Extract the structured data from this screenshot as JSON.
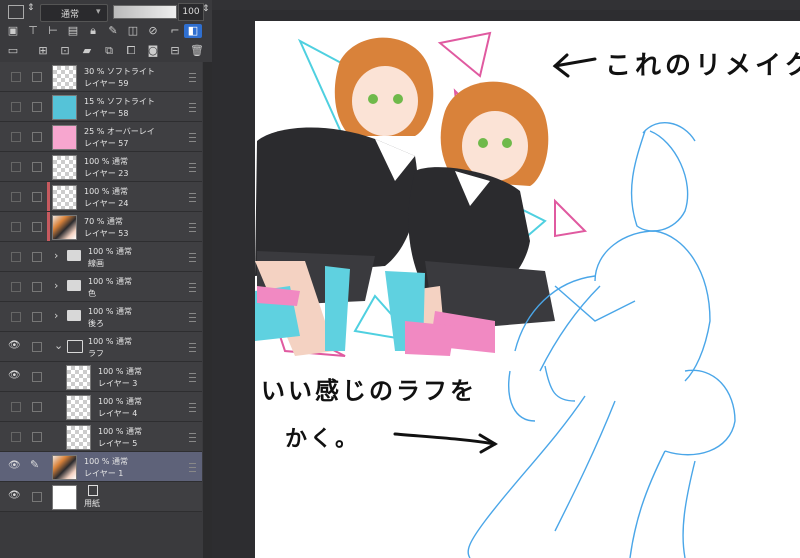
{
  "toolbar": {
    "blend_mode": "通常",
    "opacity": "100",
    "icons": [
      "layer-palette-icon",
      "new-raster-layer-icon",
      "new-vector-layer-icon",
      "lock-icon",
      "clip-icon",
      "reference-icon",
      "draft-icon",
      "mask-icon",
      "color-icon",
      "delete-icon"
    ]
  },
  "layers": [
    {
      "blend": "30 % ソフトライト",
      "name": "レイヤー 59",
      "thumb": "checker",
      "visible": false,
      "indent": 0
    },
    {
      "blend": "15 % ソフトライト",
      "name": "レイヤー 58",
      "thumb": "#55c3d8",
      "visible": false,
      "indent": 0
    },
    {
      "blend": "25 % オーバーレイ",
      "name": "レイヤー 57",
      "thumb": "#f7a6cf",
      "visible": false,
      "indent": 0
    },
    {
      "blend": "100 % 通常",
      "name": "レイヤー 23",
      "thumb": "checker",
      "visible": false,
      "indent": 0
    },
    {
      "blend": "100 % 通常",
      "name": "レイヤー 24",
      "thumb": "checker",
      "visible": false,
      "indent": 0,
      "red": true
    },
    {
      "blend": "70 % 通常",
      "name": "レイヤー 53",
      "thumb": "art",
      "visible": false,
      "indent": 0,
      "red": true
    },
    {
      "blend": "100 % 通常",
      "name": "線画",
      "thumb": "folder",
      "visible": false,
      "folder": true
    },
    {
      "blend": "100 % 通常",
      "name": "色",
      "thumb": "folder",
      "visible": false,
      "folder": true
    },
    {
      "blend": "100 % 通常",
      "name": "後ろ",
      "thumb": "folder",
      "visible": false,
      "folder": true
    },
    {
      "blend": "100 % 通常",
      "name": "ラフ",
      "thumb": "folder",
      "visible": true,
      "folder": true,
      "open": true
    },
    {
      "blend": "100 % 通常",
      "name": "レイヤー 3",
      "thumb": "checker",
      "visible": true,
      "indent": 1
    },
    {
      "blend": "100 % 通常",
      "name": "レイヤー 4",
      "thumb": "checker",
      "visible": false,
      "indent": 1
    },
    {
      "blend": "100 % 通常",
      "name": "レイヤー 5",
      "thumb": "checker",
      "visible": false,
      "indent": 1
    },
    {
      "blend": "100 % 通常",
      "name": "レイヤー 1",
      "thumb": "art",
      "visible": true,
      "indent": 0,
      "selected": true,
      "pen": true
    },
    {
      "blend": "",
      "name": "用紙",
      "thumb": "white",
      "visible": true,
      "indent": 0,
      "paper": true
    }
  ],
  "annotations": {
    "top_right": "これのリメイク",
    "bottom_left_1": "いい感じのラフを",
    "bottom_left_2": "かく。"
  },
  "colors": {
    "panel_bg": "#3a3a3d",
    "selected_row": "#5e6279",
    "sketch_blue": "#4aa6e8",
    "accent_cyan": "#4fd0e0",
    "accent_pink": "#e05aa0"
  }
}
